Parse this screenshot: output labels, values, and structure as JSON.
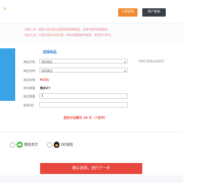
{
  "colors": {
    "brand": "#e8a33a",
    "blue": "#3aa3e8",
    "red": "#e8473e"
  },
  "header": {
    "logo_text": "⊕",
    "btn_orange": "订单查询",
    "btn_blue": "商户登录"
  },
  "notice": {
    "line1": "商家公告：提取卡密后请立即更改密码和绑定，系统不提供找回服务",
    "line2": "购买公告：付款后请勿关闭页面，如有问题请联系客服，并提供订单号。"
  },
  "form": {
    "section_title": "选择商品",
    "category_label": "商品分类",
    "category_value": "测试商品",
    "product_label": "商品名称",
    "product_value": "测试商品",
    "price_label": "商品价格",
    "price_value": "¥10元",
    "stock_label": "库存数量",
    "stock_value": "剩余3个",
    "qty_label": "购买数量",
    "qty_value": "1",
    "contact_label": "联系QQ",
    "contact_value": "",
    "side_note": "付款后系统自动发货",
    "total_text": "您应付总额为 10 元（人民币）"
  },
  "payment": {
    "wechat_label": "微信支付",
    "qq_label": "QQ钱包"
  },
  "confirm_label": "确认选择，进行下一步"
}
